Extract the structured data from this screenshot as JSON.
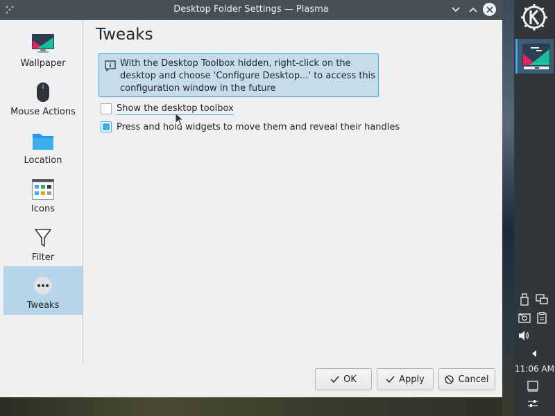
{
  "window": {
    "title": "Desktop Folder Settings — Plasma"
  },
  "sidebar": {
    "items": [
      {
        "label": "Wallpaper",
        "icon": "monitor-icon",
        "selected": false
      },
      {
        "label": "Mouse Actions",
        "icon": "mouse-icon",
        "selected": false
      },
      {
        "label": "Location",
        "icon": "folder-icon",
        "selected": false
      },
      {
        "label": "Icons",
        "icon": "icons-view-icon",
        "selected": false
      },
      {
        "label": "Filter",
        "icon": "filter-icon",
        "selected": false
      },
      {
        "label": "Tweaks",
        "icon": "more-dots-icon",
        "selected": true
      }
    ]
  },
  "main": {
    "title": "Tweaks",
    "info_message": "With the Desktop Toolbox hidden, right-click on the desktop and choose 'Configure Desktop...' to access this configuration window in the future",
    "options": [
      {
        "label": "Show the desktop toolbox",
        "checked": false
      },
      {
        "label": "Press and hold widgets to move them and reveal their handles",
        "checked": true
      }
    ]
  },
  "footer": {
    "ok_label": "OK",
    "apply_label": "Apply",
    "cancel_label": "Cancel"
  },
  "panel": {
    "clock": "11:06 AM"
  },
  "colors": {
    "accent": "#3daee9",
    "titlebar": "#475057",
    "panel": "#31363b",
    "selection": "#b6d5ea"
  }
}
